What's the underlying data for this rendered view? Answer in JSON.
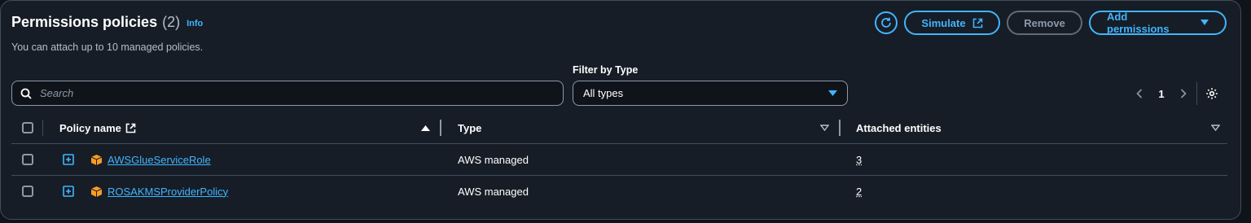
{
  "header": {
    "title": "Permissions policies",
    "count": "(2)",
    "info_label": "Info",
    "subtitle": "You can attach up to 10 managed policies."
  },
  "actions": {
    "refresh_icon": "refresh-icon",
    "simulate_label": "Simulate",
    "remove_label": "Remove",
    "add_permissions_label": "Add permissions"
  },
  "search": {
    "placeholder": "Search",
    "value": ""
  },
  "filter": {
    "label": "Filter by Type",
    "selected": "All types"
  },
  "pagination": {
    "current_page": "1"
  },
  "table": {
    "columns": {
      "policy_name": "Policy name",
      "type": "Type",
      "attached_entities": "Attached entities"
    },
    "rows": [
      {
        "policy_name": "AWSGlueServiceRole",
        "type": "AWS managed",
        "attached_entities": "3"
      },
      {
        "policy_name": "ROSAKMSProviderPolicy",
        "type": "AWS managed",
        "attached_entities": "2"
      }
    ]
  },
  "colors": {
    "accent": "#42b4ff",
    "panel_bg": "#161d26",
    "border": "#414d5c",
    "policy_icon": "#f89c24"
  }
}
